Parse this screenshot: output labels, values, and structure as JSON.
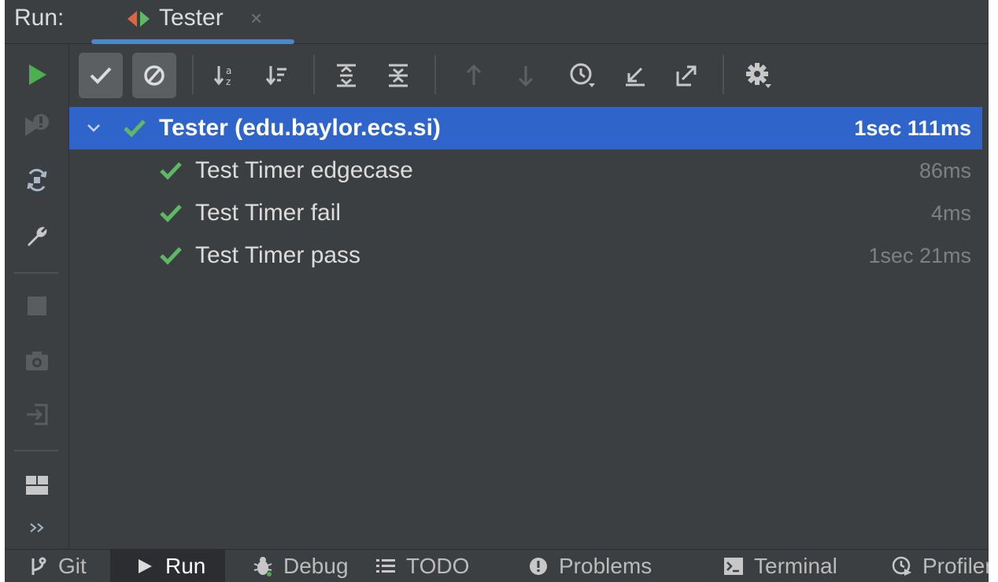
{
  "header": {
    "run_label": "Run:",
    "tab": {
      "title": "Tester",
      "close": "×"
    }
  },
  "top_toolbar": {
    "buttons": [
      {
        "icon": "check-icon",
        "name": "show-passed-button",
        "toggled": true
      },
      {
        "icon": "ignored-icon",
        "name": "show-ignored-button",
        "toggled": true
      },
      {
        "icon": "sort-alphabetically-icon",
        "name": "sort-alphabetically-button"
      },
      {
        "icon": "sort-by-duration-icon",
        "name": "sort-by-duration-button"
      },
      {
        "icon": "expand-all-icon",
        "name": "expand-all-button"
      },
      {
        "icon": "collapse-all-icon",
        "name": "collapse-all-button"
      },
      {
        "icon": "arrow-up-icon",
        "name": "previous-failed-test-button"
      },
      {
        "icon": "arrow-down-icon",
        "name": "next-failed-test-button"
      },
      {
        "icon": "history-icon",
        "name": "test-history-button"
      },
      {
        "icon": "import-tests-icon",
        "name": "import-tests-button"
      },
      {
        "icon": "export-tests-icon",
        "name": "export-tests-button"
      },
      {
        "icon": "gear-icon",
        "name": "settings-button"
      }
    ]
  },
  "left_toolbar": {
    "buttons": [
      {
        "icon": "play-icon",
        "name": "rerun-button"
      },
      {
        "icon": "rerun-failed-icon",
        "name": "rerun-failed-button"
      },
      {
        "icon": "toggle-autotest-icon",
        "name": "toggle-auto-test-button"
      },
      {
        "icon": "wrench-icon",
        "name": "edit-configuration-button"
      },
      {
        "icon": "stop-icon",
        "name": "stop-button"
      },
      {
        "icon": "camera-icon",
        "name": "screenshot-button"
      },
      {
        "icon": "exit-icon",
        "name": "exit-button"
      },
      {
        "icon": "layout-icon",
        "name": "layout-button"
      },
      {
        "icon": "more-icon",
        "name": "more-button"
      }
    ]
  },
  "tree": {
    "root": {
      "label": "Tester (edu.baylor.ecs.si)",
      "time": "1sec 111ms"
    },
    "children": [
      {
        "label": "Test Timer edgecase",
        "time": "86ms"
      },
      {
        "label": "Test Timer fail",
        "time": "4ms"
      },
      {
        "label": "Test Timer pass",
        "time": "1sec 21ms"
      }
    ]
  },
  "bottom_bar": {
    "items": [
      {
        "label": "Git",
        "icon": "git-branch-icon"
      },
      {
        "label": "Run",
        "icon": "play-icon",
        "active": true
      },
      {
        "label": "Debug",
        "icon": "bug-icon"
      },
      {
        "label": "TODO",
        "icon": "list-icon"
      },
      {
        "label": "Problems",
        "icon": "warning-icon"
      },
      {
        "label": "Terminal",
        "icon": "terminal-icon"
      },
      {
        "label": "Profiler",
        "icon": "profiler-icon"
      }
    ]
  },
  "colors": {
    "background": "#3c3f41",
    "selection": "#2f65ca",
    "passed": "#5fb863",
    "run_green": "#4caf50",
    "tab_underline": "#4a88c7"
  }
}
